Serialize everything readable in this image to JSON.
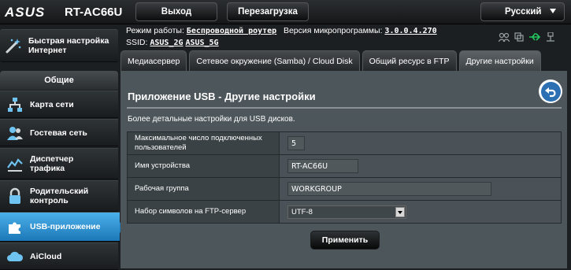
{
  "header": {
    "brand": "ASUS",
    "model": "RT-AC66U",
    "logout_label": "Выход",
    "reboot_label": "Перезагрузка",
    "language": "Русский"
  },
  "info": {
    "mode_label": "Режим работы:",
    "mode_value": "Беспроводной роутер",
    "firmware_label": "Версия микропрограммы:",
    "firmware_value": "3.0.0.4.270",
    "ssid_label": "SSID:",
    "ssid_2g": "ASUS_2G",
    "ssid_5g": "ASUS_5G"
  },
  "sidebar": {
    "quick_setup": "Быстрая настройка Интернет",
    "section_general": "Общие",
    "items": [
      {
        "label": "Карта сети"
      },
      {
        "label": "Гостевая сеть"
      },
      {
        "label": "Диспетчер трафика"
      },
      {
        "label": "Родительский контроль"
      },
      {
        "label": "USB-приложение"
      },
      {
        "label": "AiCloud"
      }
    ]
  },
  "tabs": [
    {
      "label": "Медиасервер"
    },
    {
      "label": "Сетевое окружение (Samba) / Cloud Disk"
    },
    {
      "label": "Общий ресурс в FTP"
    },
    {
      "label": "Другие настройки"
    }
  ],
  "main": {
    "title": "Приложение USB - Другие настройки",
    "description": "Более детальные настройки для USB дисков.",
    "rows": [
      {
        "label": "Максимальное число подключенных пользователей",
        "value": "5"
      },
      {
        "label": "Имя устройства",
        "value": "RT-AC66U"
      },
      {
        "label": "Рабочая группа",
        "value": "WORKGROUP"
      },
      {
        "label": "Набор символов на FTP-сервер",
        "value": "UTF-8"
      }
    ],
    "apply_label": "Применить"
  },
  "colors": {
    "accent": "#1c78b8",
    "panel": "#4d565b",
    "usb_icon_green": "#22c55e"
  }
}
